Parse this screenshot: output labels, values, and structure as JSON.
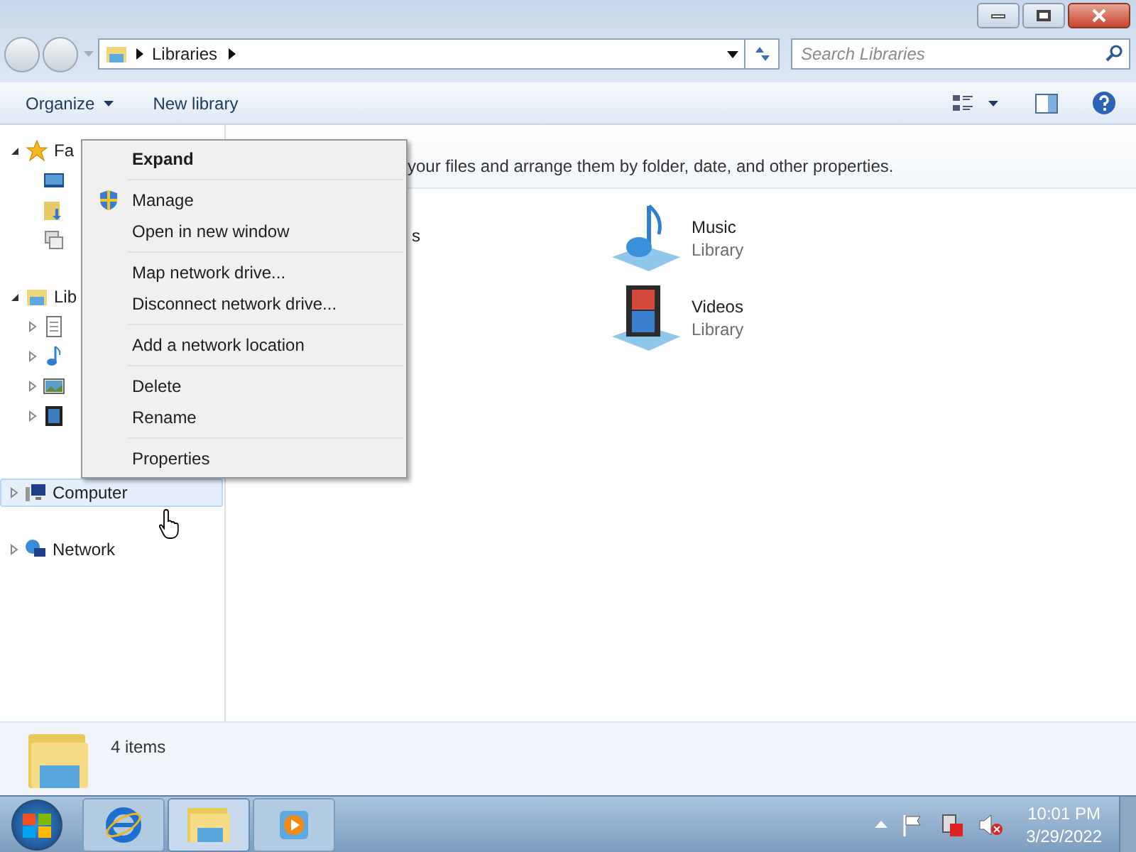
{
  "address": {
    "path": "Libraries"
  },
  "search": {
    "placeholder": "Search Libraries"
  },
  "toolbar": {
    "items": [
      {
        "label": "Organize"
      },
      {
        "label": "New library"
      }
    ]
  },
  "sidebar": {
    "items": [
      {
        "label": "Fa",
        "expanded": true,
        "selected": false,
        "children": [
          {
            "expandable": false
          },
          {
            "expandable": false
          },
          {
            "expandable": false
          }
        ]
      },
      {
        "label": "Lib",
        "expanded": true,
        "selected": false,
        "children": [
          {
            "expandable": true
          },
          {
            "expandable": true
          },
          {
            "expandable": true
          },
          {
            "expandable": true
          }
        ]
      },
      {
        "label": "Computer",
        "expanded": false,
        "selected": true
      },
      {
        "label": "Network",
        "expanded": false,
        "selected": false
      }
    ]
  },
  "content": {
    "description": "your files and arrange them by folder, date, and other properties.",
    "items": [
      {
        "name": "s"
      },
      {
        "name": "Music",
        "subtitle": "Library"
      },
      {
        "name": "Videos",
        "subtitle": "Library"
      }
    ]
  },
  "context_menu": {
    "groups": [
      [
        {
          "label": "Expand",
          "bold": true,
          "shield": false
        }
      ],
      [
        {
          "label": "Manage",
          "bold": false,
          "shield": true
        },
        {
          "label": "Open in new window",
          "bold": false,
          "shield": false
        }
      ],
      [
        {
          "label": "Map network drive...",
          "bold": false,
          "shield": false
        },
        {
          "label": "Disconnect network drive...",
          "bold": false,
          "shield": false
        }
      ],
      [
        {
          "label": "Add a network location",
          "bold": false,
          "shield": false
        }
      ],
      [
        {
          "label": "Delete",
          "bold": false,
          "shield": false
        },
        {
          "label": "Rename",
          "bold": false,
          "shield": false
        }
      ],
      [
        {
          "label": "Properties",
          "bold": false,
          "shield": false
        }
      ]
    ]
  },
  "status": {
    "count": "4 items"
  },
  "taskbar": {
    "apps": [
      {
        "active": false
      },
      {
        "active": true
      },
      {
        "active": false
      }
    ],
    "time": "10:01 PM",
    "date": "3/29/2022"
  }
}
